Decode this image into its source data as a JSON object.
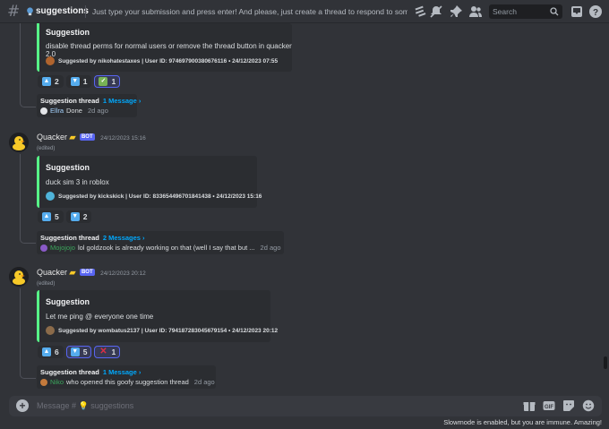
{
  "header": {
    "channel_name": "suggestions",
    "topic": "Just type your submission and press enter! And please, just create a thread to respond to someone else's",
    "search_placeholder": "Search",
    "icons": [
      "threads-icon",
      "mute-bell-icon",
      "pin-icon",
      "members-icon",
      "inbox-icon",
      "help-icon"
    ]
  },
  "messages": [
    {
      "embed": {
        "title": "Suggestion",
        "description": "disable thread perms for normal users or remove the thread button in quacker 2.0",
        "footer": "Suggested by nikohatestaxes | User ID: 974697900380676116 • 24/12/2023 07:55"
      },
      "reactions": [
        {
          "emoji": "up",
          "count": "2",
          "me": false
        },
        {
          "emoji": "down",
          "count": "1",
          "me": false
        },
        {
          "emoji": "check",
          "count": "1",
          "me": true
        }
      ],
      "thread": {
        "title": "Suggestion thread",
        "count": "1 Message ›",
        "user": "Ellra",
        "user_color": "#a6d4ff",
        "text": "Done",
        "when": "2d ago"
      }
    },
    {
      "author": "Quacker",
      "bot_tag": "BOT",
      "timestamp": "24/12/2023 15:16",
      "edited": "(edited)",
      "embed": {
        "title": "Suggestion",
        "description": "duck sim 3 in roblox",
        "footer": "Suggested by kickskick | User ID: 833654496701841438 • 24/12/2023 15:16"
      },
      "reactions": [
        {
          "emoji": "up",
          "count": "5",
          "me": false
        },
        {
          "emoji": "down",
          "count": "2",
          "me": false
        }
      ],
      "thread": {
        "title": "Suggestion thread",
        "count": "2 Messages ›",
        "user": "Mojojojo",
        "user_color": "#3ba55c",
        "text": "lol goldzook is already working on that (well I say that but ...",
        "when": "2d ago"
      }
    },
    {
      "author": "Quacker",
      "bot_tag": "BOT",
      "timestamp": "24/12/2023 20:12",
      "edited": "(edited)",
      "embed": {
        "title": "Suggestion",
        "description": "Let me ping @ everyone one time",
        "footer": "Suggested by wombatus2137 | User ID: 794187283045679154 • 24/12/2023 20:12"
      },
      "reactions": [
        {
          "emoji": "up",
          "count": "6",
          "me": false
        },
        {
          "emoji": "down",
          "count": "5",
          "me": true
        },
        {
          "emoji": "x",
          "count": "1",
          "me": true
        }
      ],
      "thread": {
        "title": "Suggestion thread",
        "count": "1 Message ›",
        "user": "Niko",
        "user_color": "#3ba55c",
        "text": "who opened this goofy suggestion thread",
        "when": "2d ago"
      }
    }
  ],
  "composer": {
    "placeholder": "Message # 💡 suggestions",
    "icons": [
      "gift-icon",
      "gif-icon",
      "sticker-icon",
      "emoji-icon"
    ]
  },
  "slowmode_notice": "Slowmode is enabled, but you are immune. Amazing!",
  "colors": {
    "background": "#313338",
    "embed_bg": "#2b2d31",
    "embed_accent": "#57f287",
    "blurple": "#5865f2",
    "link": "#00a8fc"
  }
}
